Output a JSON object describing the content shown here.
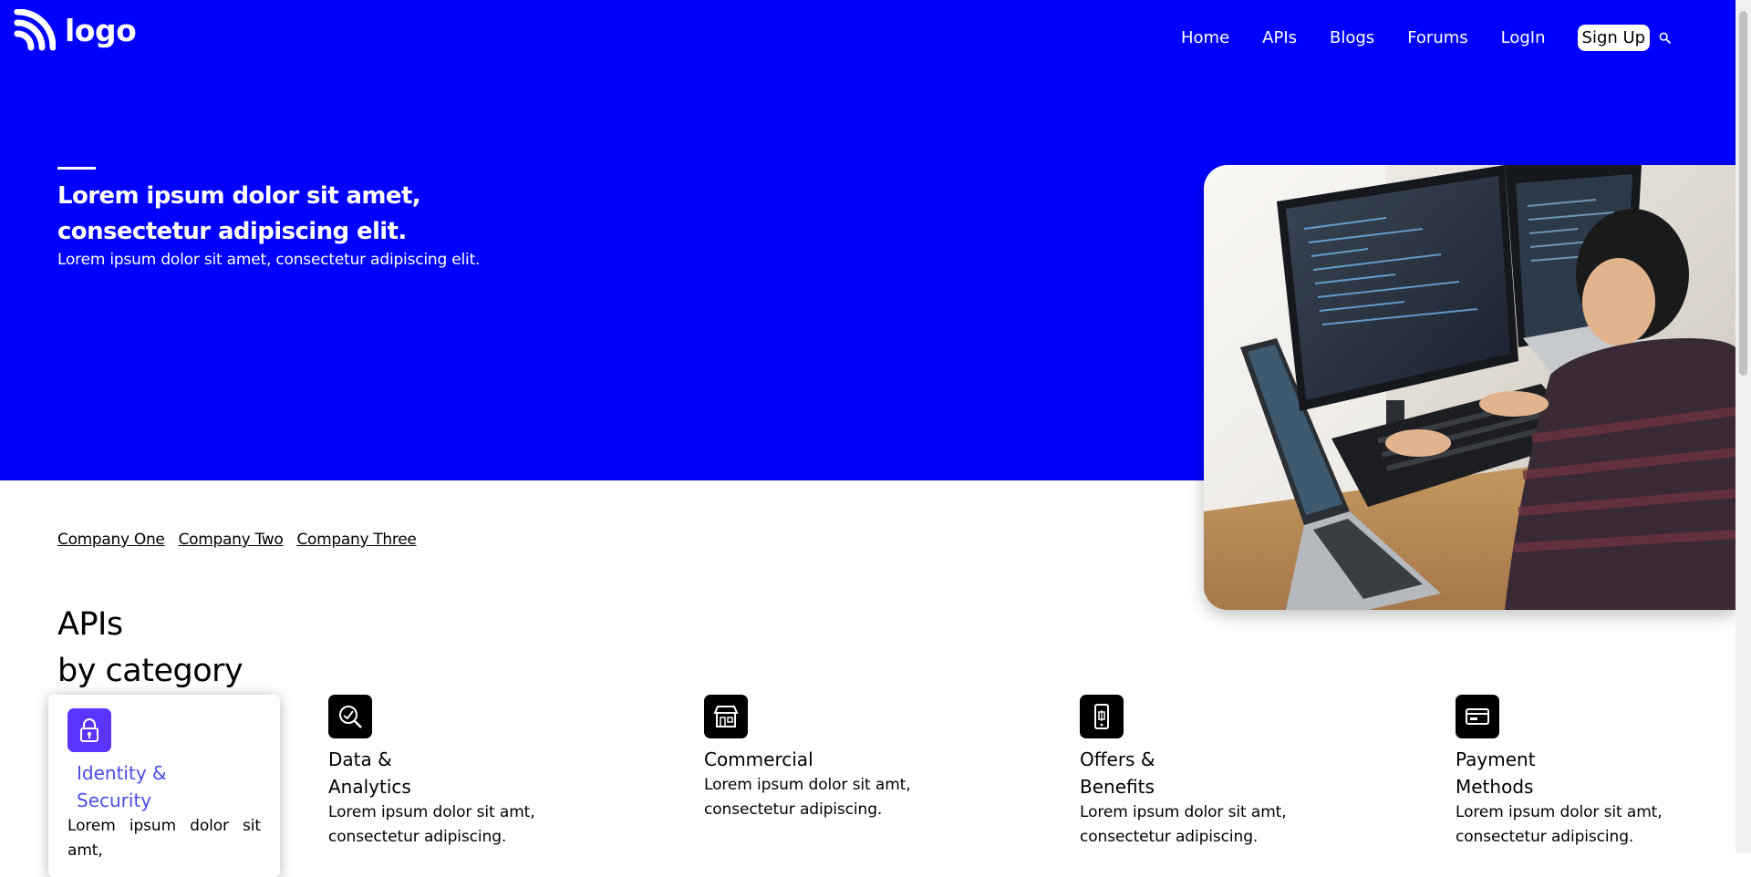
{
  "header": {
    "logo_text": "logo"
  },
  "nav": {
    "items": [
      {
        "label": "Home"
      },
      {
        "label": "APIs"
      },
      {
        "label": "Blogs"
      },
      {
        "label": "Forums"
      },
      {
        "label": "LogIn"
      }
    ],
    "signup_label": "Sign Up",
    "search_icon": "search-icon"
  },
  "hero": {
    "heading": "Lorem ipsum dolor sit amet, consectetur adipiscing elit.",
    "subtext": "Lorem ipsum dolor sit amet, consectetur adipiscing elit.",
    "image_icon": "developer-at-computer"
  },
  "companies": [
    {
      "label": "Company One"
    },
    {
      "label": "Company Two"
    },
    {
      "label": "Company Three"
    }
  ],
  "section": {
    "title_line1": "APIs",
    "title_line2": "by category"
  },
  "categories": [
    {
      "title": "Identity & Security",
      "desc": "Lorem ipsum dolor sit amt,",
      "icon": "lock-icon",
      "active": true
    },
    {
      "title": "Data & Analytics",
      "desc": "Lorem ipsum dolor sit amt, consectetur adipiscing.",
      "icon": "analytics-icon"
    },
    {
      "title": "Commercial",
      "desc": "Lorem ipsum dolor sit amt, consectetur adipiscing.",
      "icon": "storefront-icon"
    },
    {
      "title": "Offers & Benefits",
      "desc": "Lorem ipsum dolor sit amt, consectetur adipiscing.",
      "icon": "mobile-offer-icon"
    },
    {
      "title": "Payment Methods",
      "desc": "Lorem ipsum dolor sit amt, consectetur adipiscing.",
      "icon": "card-icon"
    }
  ],
  "colors": {
    "hero_bg": "#0000ff",
    "active_icon": "#5b35ff",
    "active_title": "#4a4ce8"
  }
}
